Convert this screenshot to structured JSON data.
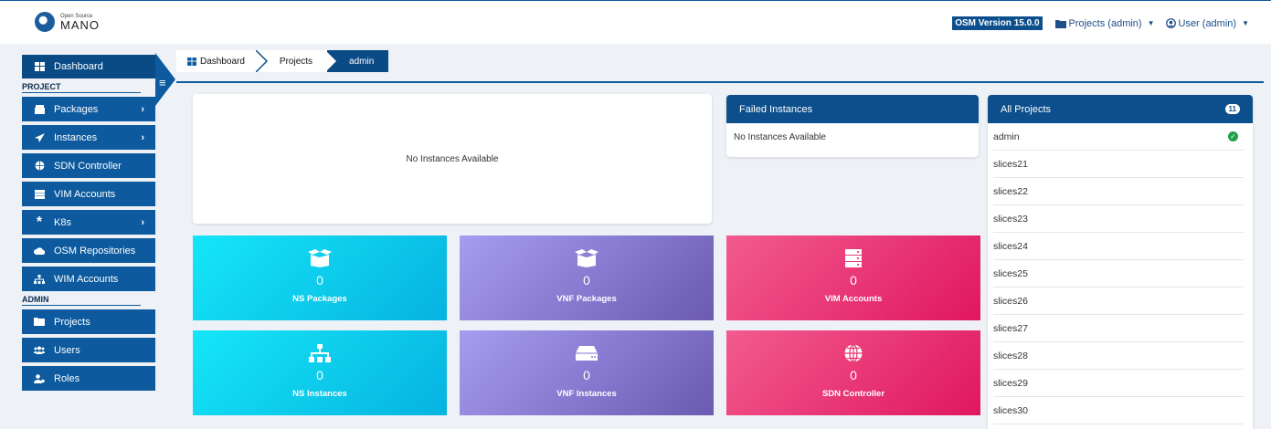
{
  "header": {
    "logo_small": "Open Source",
    "logo_big": "MANO",
    "version": "OSM Version 15.0.0",
    "projects_menu": "Projects (admin)",
    "user_menu": "User (admin)"
  },
  "sidebar": {
    "dashboard": "Dashboard",
    "section_project": "PROJECT",
    "section_admin": "ADMIN",
    "items": [
      {
        "label": "Packages"
      },
      {
        "label": "Instances"
      },
      {
        "label": "SDN Controller"
      },
      {
        "label": "VIM Accounts"
      },
      {
        "label": "K8s"
      },
      {
        "label": "OSM Repositories"
      },
      {
        "label": "WIM Accounts"
      }
    ],
    "admin_items": [
      {
        "label": "Projects"
      },
      {
        "label": "Users"
      },
      {
        "label": "Roles"
      }
    ]
  },
  "breadcrumb": [
    "Dashboard",
    "Projects",
    "admin"
  ],
  "main_card": {
    "text": "No Instances Available"
  },
  "failed": {
    "title": "Failed Instances",
    "text": "No Instances Available"
  },
  "all_projects": {
    "title": "All Projects",
    "count": "11",
    "items": [
      "admin",
      "slices21",
      "slices22",
      "slices23",
      "slices24",
      "slices25",
      "slices26",
      "slices27",
      "slices28",
      "slices29",
      "slices30"
    ]
  },
  "tiles": [
    {
      "value": "0",
      "label": "NS Packages"
    },
    {
      "value": "0",
      "label": "VNF Packages"
    },
    {
      "value": "0",
      "label": "VIM Accounts"
    },
    {
      "value": "0",
      "label": "NS Instances"
    },
    {
      "value": "0",
      "label": "VNF Instances"
    },
    {
      "value": "0",
      "label": "SDN Controller"
    }
  ],
  "colors": {
    "primary": "#0d5a9e",
    "header_dark": "#0d4f8c",
    "cyan": "#06b3e0",
    "purple": "#6a5ab1",
    "pink": "#e0175f"
  }
}
